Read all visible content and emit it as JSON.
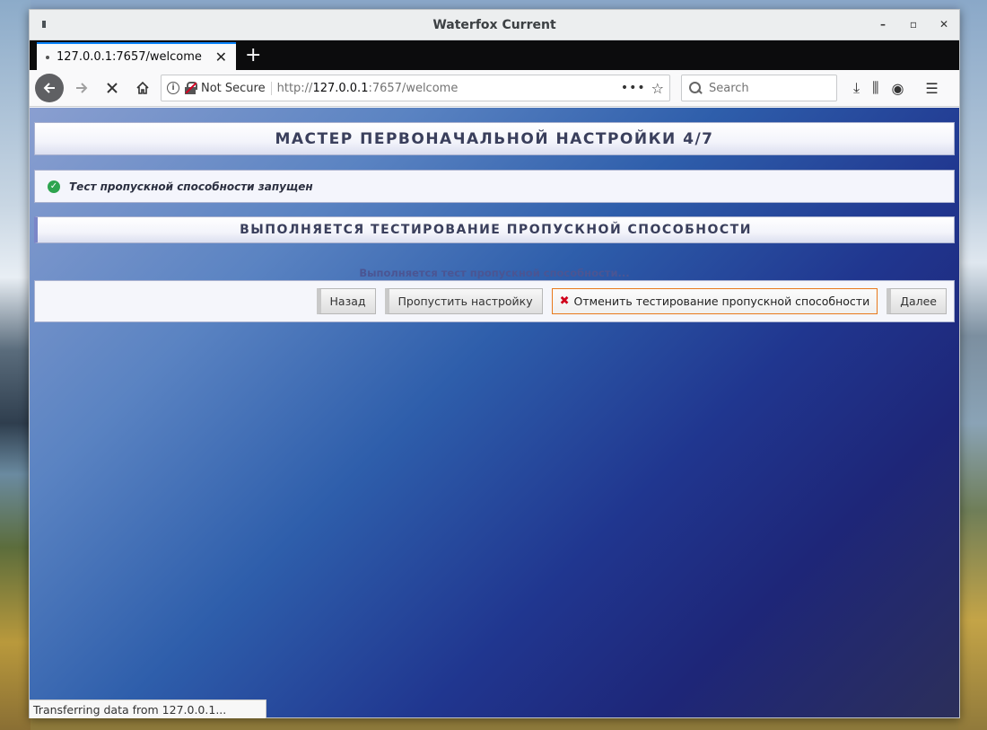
{
  "window": {
    "title": "Waterfox Current"
  },
  "tab": {
    "label": "127.0.0.1:7657/welcome",
    "close": "✕"
  },
  "newtab": "+",
  "nav": {
    "security_label": "Not Secure",
    "url_prefix": "http://",
    "url_host": "127.0.0.1",
    "url_rest": ":7657/welcome",
    "search_placeholder": "Search"
  },
  "page": {
    "wizard_title": "МАСТЕР ПЕРВОНАЧАЛЬНОЙ НАСТРОЙКИ 4/7",
    "notice": "Тест пропускной способности запущен",
    "section_title": "ВЫПОЛНЯЕТСЯ ТЕСТИРОВАНИЕ ПРОПУСКНОЙ СПОСОБНОСТИ",
    "progress_text": "Выполняется тест пропускной способности...",
    "buttons": {
      "back": "Назад",
      "skip": "Пропустить настройку",
      "cancel": "Отменить тестирование пропускной способности",
      "next": "Далее"
    }
  },
  "statusbar": {
    "text": "Transferring data from 127.0.0.1..."
  },
  "colors": {
    "accent": "#0a84ff",
    "success": "#2ea44f",
    "cancel_border": "#e8791c",
    "cancel_icon": "#d0021b"
  }
}
